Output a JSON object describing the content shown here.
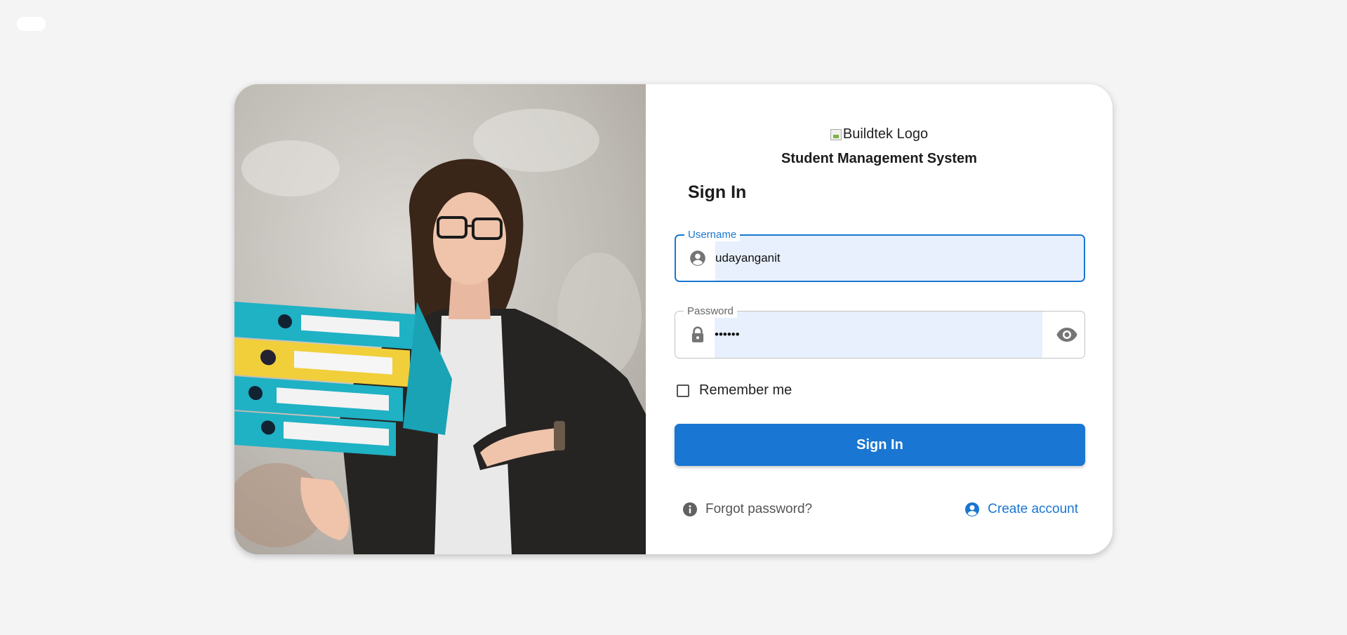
{
  "logo": {
    "alt_text": "Buildtek Logo"
  },
  "app": {
    "title": "Student Management System"
  },
  "form": {
    "heading": "Sign In",
    "username": {
      "label": "Username",
      "value": "udayanganit"
    },
    "password": {
      "label": "Password",
      "value": "••••••"
    },
    "remember_label": "Remember me",
    "submit_label": "Sign In"
  },
  "links": {
    "forgot": "Forgot password?",
    "create": "Create account"
  },
  "colors": {
    "primary": "#1976d2",
    "autofill": "#e8f0fe",
    "page_background": "#f4f4f4"
  },
  "icons": [
    "account-circle-icon",
    "lock-icon",
    "eye-icon",
    "info-icon",
    "account-circle-icon"
  ]
}
